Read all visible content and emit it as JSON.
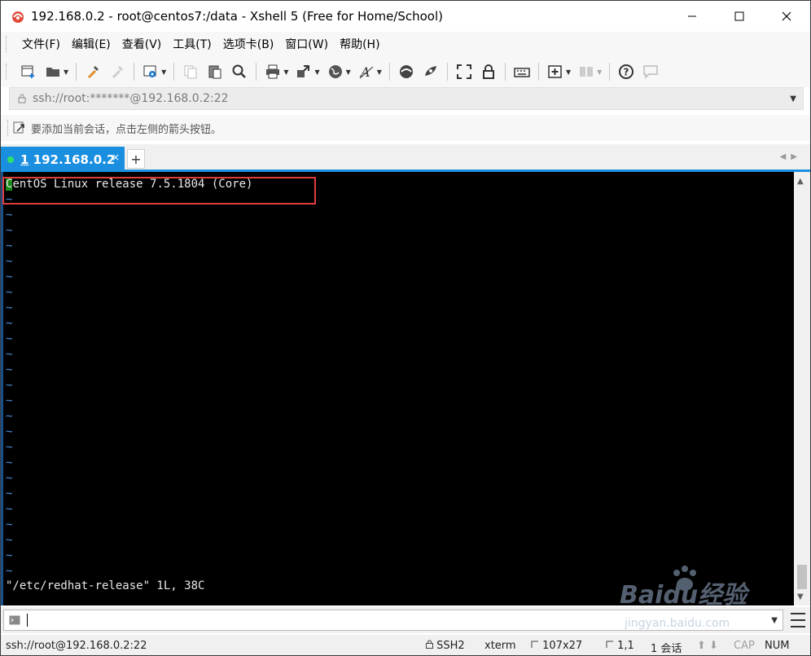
{
  "window": {
    "title": "192.168.0.2 - root@centos7:/data - Xshell 5 (Free for Home/School)"
  },
  "menu": [
    "文件(F)",
    "编辑(E)",
    "查看(V)",
    "工具(T)",
    "选项卡(B)",
    "窗口(W)",
    "帮助(H)"
  ],
  "toolbar": {
    "icons": [
      "new-session-icon",
      "open-folder-icon",
      "reconnect-icon",
      "disconnect-icon",
      "properties-icon",
      "copy-icon",
      "paste-icon",
      "find-icon",
      "print-icon",
      "transfer-icon",
      "globe-icon",
      "font-icon",
      "xftp-icon",
      "xmanager-icon",
      "fullscreen-icon",
      "lock-icon",
      "keyboard-icon",
      "compose-add-icon",
      "layout-icon",
      "help-icon",
      "chat-icon"
    ]
  },
  "address": {
    "value": "ssh://root:*******@192.168.0.2:22"
  },
  "hint": {
    "text": "要添加当前会话，点击左侧的箭头按钮。"
  },
  "tabs": [
    {
      "number": "1",
      "label": "192.168.0.2",
      "close": "×"
    }
  ],
  "tab_add_label": "+",
  "terminal": {
    "first_char": "C",
    "first_line_rest": "entOS Linux release 7.5.1804 (Core)",
    "tilde": "~",
    "tilde_rows": 25,
    "status_line": "\"/etc/redhat-release\" 1L, 38C",
    "highlight_color": "#e03c3c"
  },
  "status": {
    "connection": "ssh://root@192.168.0.2:22",
    "protocol": "SSH2",
    "term": "xterm",
    "size": "107x27",
    "cursor_pos": "1,1",
    "sessions": "1 会话",
    "caps": "CAP",
    "num": "NUM"
  },
  "watermark": {
    "main": "Baidu经验",
    "sub": "jingyan.baidu.com"
  },
  "colors": {
    "tab_active": "#1a8fe0",
    "terminal_bg": "#000000",
    "tilde": "#4a90e2"
  }
}
